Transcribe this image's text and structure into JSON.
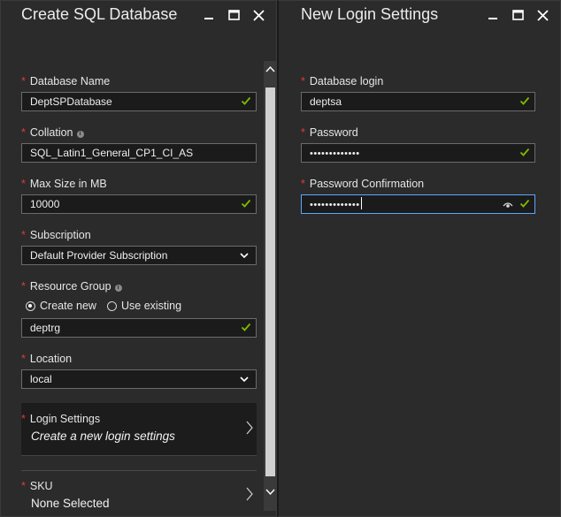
{
  "left_blade": {
    "title": "Create SQL Database",
    "fields": {
      "database_name": {
        "label": "Database Name",
        "value": "DeptSPDatabase"
      },
      "collation": {
        "label": "Collation",
        "value": "SQL_Latin1_General_CP1_CI_AS"
      },
      "max_size": {
        "label": "Max Size in MB",
        "value": "10000"
      },
      "subscription": {
        "label": "Subscription",
        "value": "Default Provider Subscription"
      },
      "resource_group": {
        "label": "Resource Group",
        "option_new": "Create new",
        "option_existing": "Use existing",
        "selected": "Create new",
        "value": "deptrg"
      },
      "location": {
        "label": "Location",
        "value": "local"
      }
    },
    "login_settings": {
      "label": "Login Settings",
      "subtitle": "Create a new login settings"
    },
    "sku": {
      "label": "SKU",
      "value": "None Selected"
    },
    "info_glyph": "i"
  },
  "right_blade": {
    "title": "New Login Settings",
    "fields": {
      "database_login": {
        "label": "Database login",
        "value": "deptsa"
      },
      "password": {
        "label": "Password",
        "value": "•••••••••••••"
      },
      "password_confirmation": {
        "label": "Password Confirmation",
        "value": "•••••••••••••"
      }
    }
  },
  "colors": {
    "required": "#e03a3a",
    "check": "#7fba00",
    "focus": "#5aa7ff",
    "panel": "#2b2b2b"
  },
  "required_mark": "*"
}
